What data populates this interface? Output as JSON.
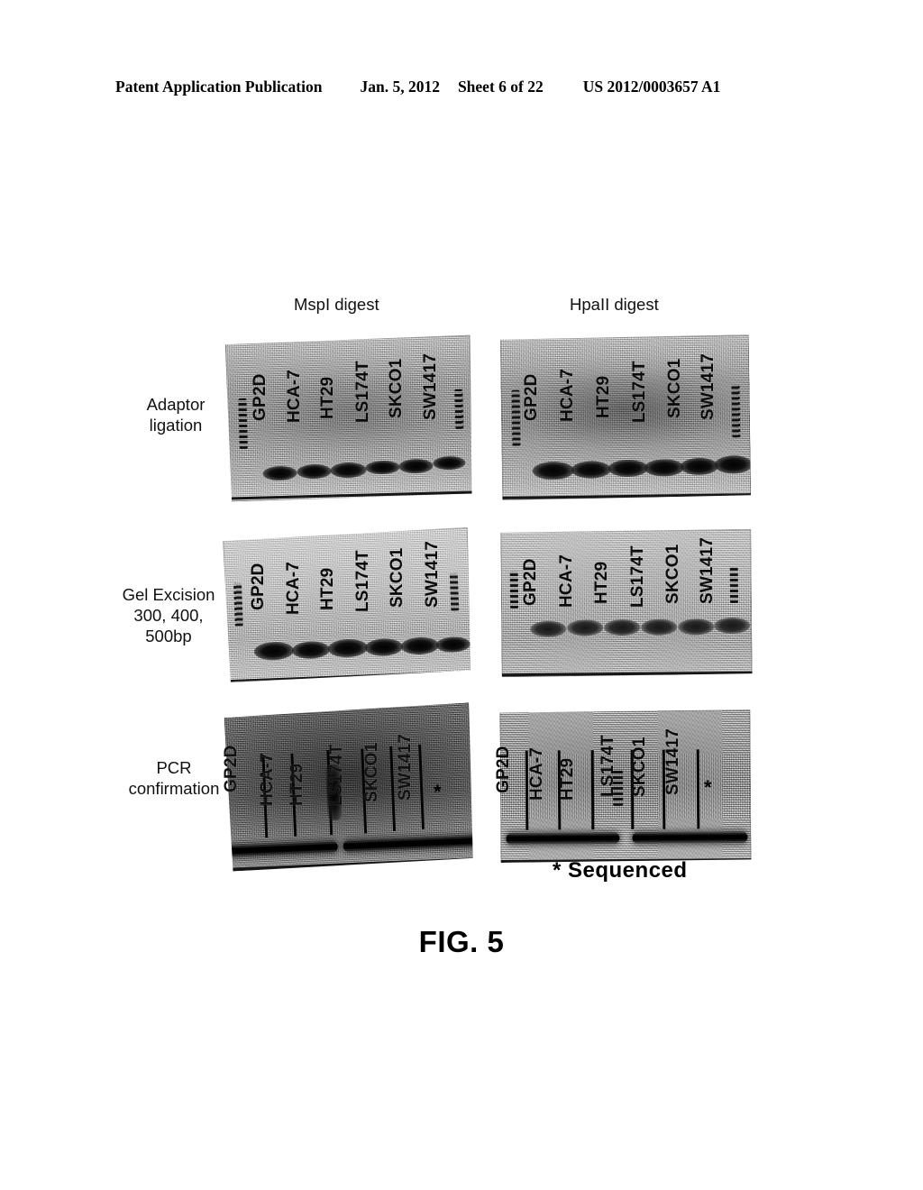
{
  "header": {
    "publication": "Patent Application Publication",
    "date": "Jan. 5, 2012",
    "sheet": "Sheet 6 of 22",
    "number": "US 2012/0003657 A1"
  },
  "figure": {
    "caption": "FIG. 5",
    "footnote": "* Sequenced",
    "column_titles": [
      {
        "id": "mspi",
        "label": "MspI digest"
      },
      {
        "id": "hpaii",
        "label": "HpaII digest"
      }
    ],
    "row_labels": [
      {
        "id": "adaptor",
        "label": "Adaptor\nligation"
      },
      {
        "id": "gel",
        "label": "Gel Excision\n300, 400,\n500bp"
      },
      {
        "id": "pcr",
        "label": "PCR\nconfirmation"
      }
    ],
    "lanes": [
      "GP2D",
      "HCA-7",
      "HT29",
      "LS174T",
      "SKCO1",
      "SW1417"
    ],
    "panels": [
      {
        "id": "adaptor-mspi",
        "row": "Adaptor ligation",
        "column": "MspI digest",
        "lanes": [
          "GP2D",
          "HCA-7",
          "HT29",
          "LS174T",
          "SKCO1",
          "SW1417"
        ]
      },
      {
        "id": "adaptor-hpaii",
        "row": "Adaptor ligation",
        "column": "HpaII digest",
        "lanes": [
          "GP2D",
          "HCA-7",
          "HT29",
          "LS174T",
          "SKCO1",
          "SW1417"
        ]
      },
      {
        "id": "gel-mspi",
        "row": "Gel Excision",
        "column": "MspI digest",
        "lanes": [
          "GP2D",
          "HCA-7",
          "HT29",
          "LS174T",
          "SKCO1",
          "SW1417"
        ]
      },
      {
        "id": "gel-hpaii",
        "row": "Gel Excision",
        "column": "HpaII digest",
        "lanes": [
          "GP2D",
          "HCA-7",
          "HT29",
          "LS174T",
          "SKCO1",
          "SW1417"
        ]
      },
      {
        "id": "pcr-mspi",
        "row": "PCR confirmation",
        "column": "MspI digest",
        "lanes": [
          "GP2D",
          "HCA-7",
          "HT29",
          "LS174T",
          "SKCO1",
          "SW1417"
        ]
      },
      {
        "id": "pcr-hpaii",
        "row": "PCR confirmation",
        "column": "HpaII digest",
        "lanes": [
          "GP2D",
          "HCA-7",
          "HT29",
          "LS174T",
          "SKCO1",
          "SW1417"
        ],
        "marked_lane": "SW1417",
        "mark": "*"
      }
    ]
  },
  "colors": {
    "ink": "#000000",
    "paper": "#ffffff",
    "gel_background": "#b4b4b4",
    "band": "#080808"
  }
}
